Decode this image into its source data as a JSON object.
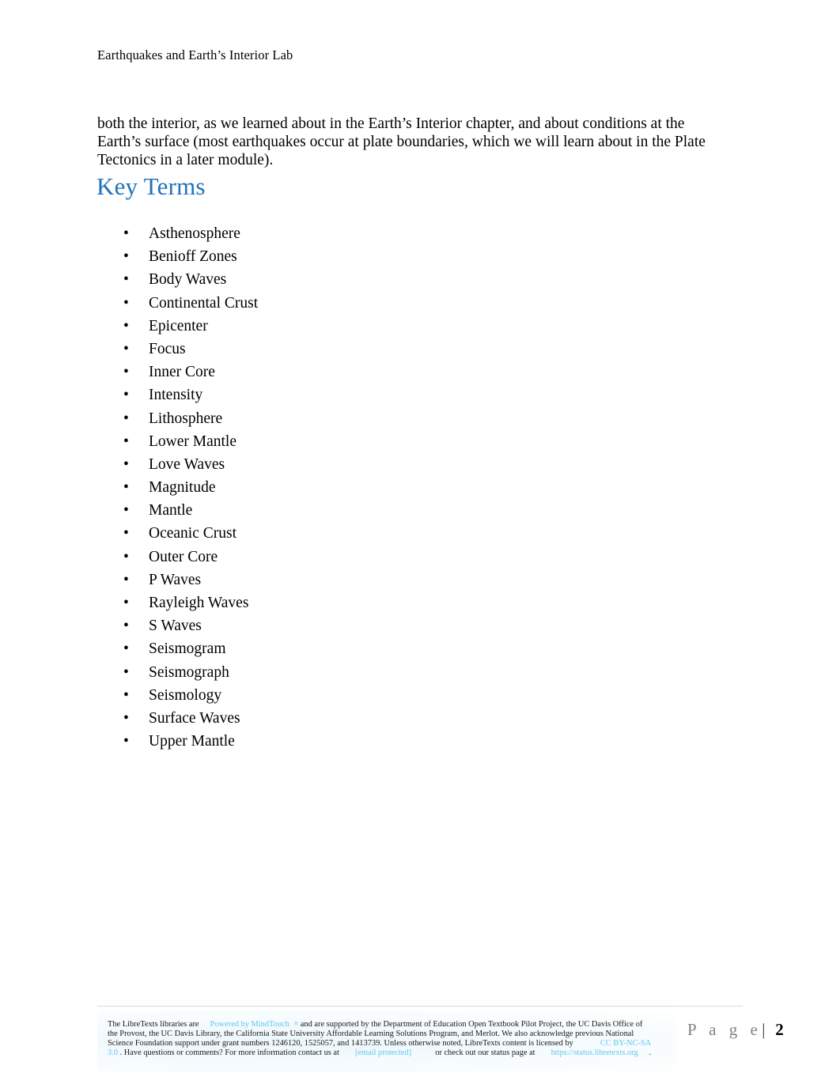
{
  "document": {
    "running_header": "Earthquakes and Earth’s Interior Lab",
    "body_paragraph": "both the interior, as we learned about in the Earth’s Interior chapter, and about conditions at the Earth’s surface (most earthquakes occur at plate boundaries, which we will learn about in the Plate Tectonics in a later module).",
    "section_heading": "Key Terms",
    "bullet_glyph": "•",
    "heading_color": "#2072B8",
    "link_color": "#5DC8F0"
  },
  "key_terms": [
    "Asthenosphere",
    "Benioff Zones",
    "Body Waves",
    "Continental Crust",
    "Epicenter",
    "Focus",
    "Inner Core",
    "Intensity",
    "Lithosphere",
    "Lower Mantle",
    "Love Waves",
    "Magnitude",
    "Mantle",
    "Oceanic Crust",
    "Outer Core",
    "P Waves",
    "Rayleigh Waves",
    "S Waves",
    "Seismogram",
    "Seismograph",
    "Seismology",
    "Surface Waves",
    "Upper Mantle"
  ],
  "footer": {
    "seg1": "The LibreTexts libraries are",
    "link_mindtouch": "Powered by MindTouch",
    "trademark": "®",
    "seg2": "and are supported by the Department of Education Open Textbook Pilot Project, the UC Davis Office of the Provost, the UC Davis Library, the California State University Affordable Learning Solutions Program, and Merlot. We also acknowledge previous National Science Foundation support under grant numbers 1246120, 1525057, and 1413739. Unless otherwise noted, LibreTexts content is licensed by",
    "link_license_1": "CC BY-NC-SA",
    "link_license_2": "3.0",
    "seg3": ". Have questions or comments? For more information contact us at",
    "link_email": "[email protected]",
    "seg4": "or check out our status page at",
    "link_status": "https://status.libretexts.org",
    "seg5": ".",
    "page_label": "P a g e",
    "page_separator": "|",
    "page_number": "2"
  }
}
